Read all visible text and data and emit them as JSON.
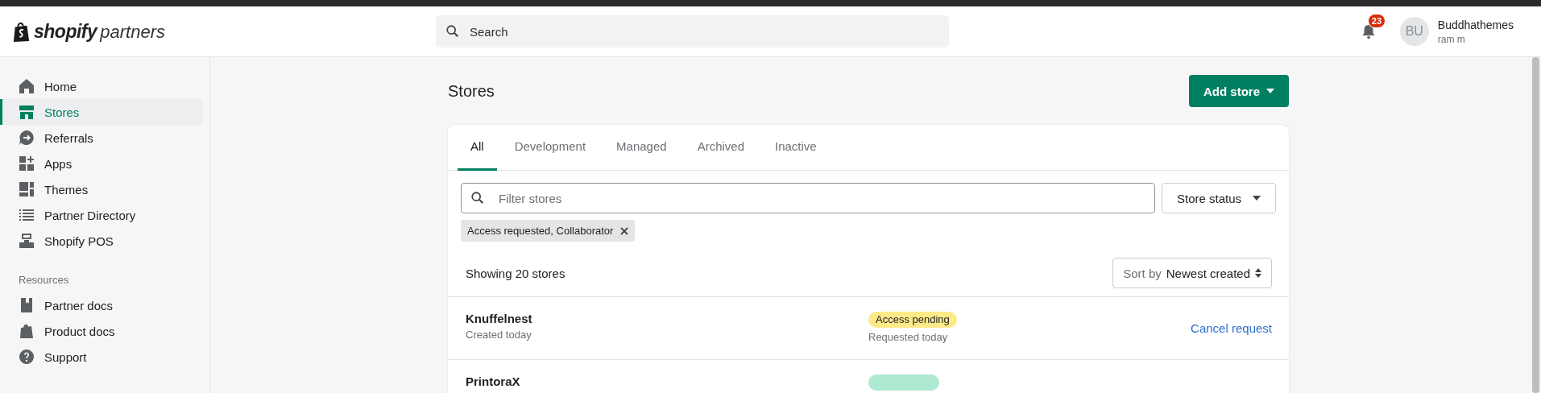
{
  "header": {
    "logo_bold": "shopify",
    "logo_light": "partners",
    "search": {
      "placeholder": "Search"
    },
    "notifications": {
      "count": "23"
    },
    "user": {
      "initials": "BU",
      "name": "Buddhathemes",
      "subtitle": "ram m"
    }
  },
  "sidebar": {
    "items": [
      {
        "label": "Home",
        "selected": false
      },
      {
        "label": "Stores",
        "selected": true
      },
      {
        "label": "Referrals",
        "selected": false
      },
      {
        "label": "Apps",
        "selected": false
      },
      {
        "label": "Themes",
        "selected": false
      },
      {
        "label": "Partner Directory",
        "selected": false
      },
      {
        "label": "Shopify POS",
        "selected": false
      }
    ],
    "resources_heading": "Resources",
    "resources": [
      {
        "label": "Partner docs",
        "selected": false
      },
      {
        "label": "Product docs",
        "selected": false
      },
      {
        "label": "Support",
        "selected": false
      }
    ]
  },
  "page": {
    "title": "Stores",
    "add_button": "Add store",
    "tabs": [
      {
        "label": "All",
        "selected": true
      },
      {
        "label": "Development",
        "selected": false
      },
      {
        "label": "Managed",
        "selected": false
      },
      {
        "label": "Archived",
        "selected": false
      },
      {
        "label": "Inactive",
        "selected": false
      }
    ],
    "filter": {
      "placeholder": "Filter stores"
    },
    "status_button": "Store status",
    "chips": [
      {
        "label": "Access requested, Collaborator"
      }
    ],
    "count_text": "Showing 20 stores",
    "sort": {
      "prefix": "Sort by",
      "value": "Newest created"
    },
    "rows": [
      {
        "name": "Knuffelnest",
        "created": "Created today",
        "status": "Access pending",
        "color": "#ffea8a",
        "status_note": "Requested today",
        "action": "Cancel request"
      },
      {
        "name": "PrintoraX",
        "color": "#aee9d1"
      }
    ]
  }
}
